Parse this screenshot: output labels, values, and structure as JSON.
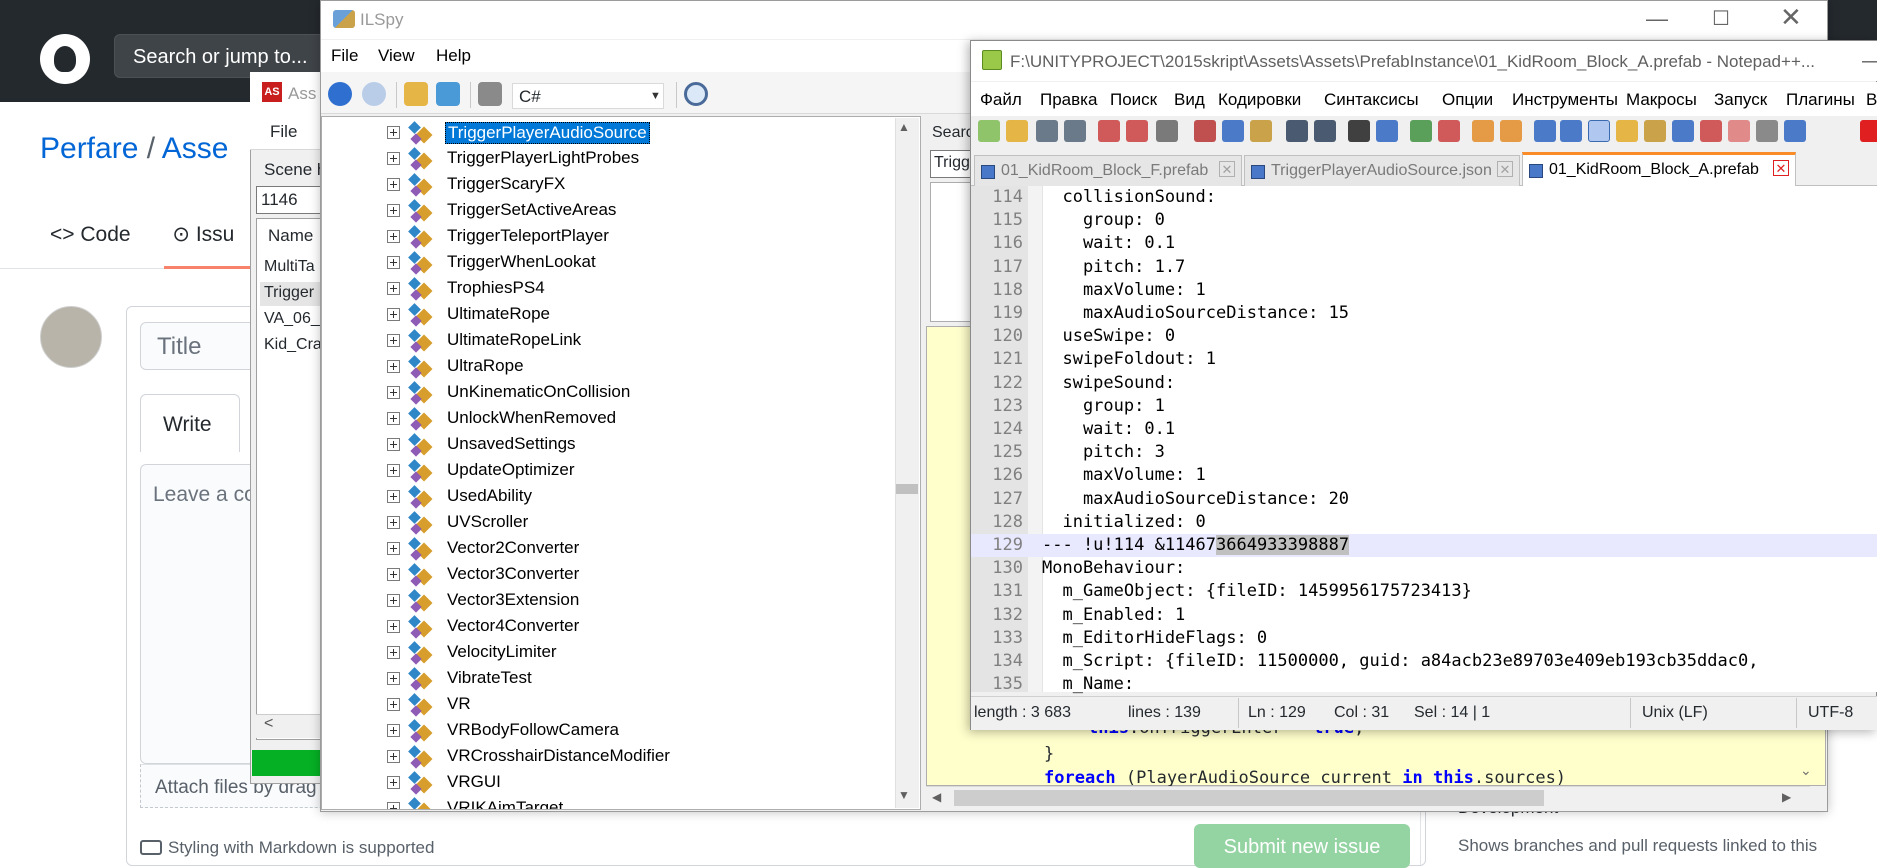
{
  "github": {
    "search_placeholder": "Search or jump to...",
    "repo_owner": "Perfare",
    "repo_sep": "/",
    "repo_name": "Asse",
    "tab_code": "<> Code",
    "tab_issues": "⊙ Issu",
    "title_placeholder": "Title",
    "write_tab": "Write",
    "comment_placeholder": "Leave a co",
    "attach_text": "Attach files by drag",
    "markdown_note": "Styling with Markdown is supported",
    "submit_label": "Submit new issue",
    "dev_title": "Development",
    "dev_desc": "Shows branches and pull requests linked to this"
  },
  "assetstudio": {
    "title": "Ass",
    "menu_file": "File",
    "scene_label": "Scene h",
    "search_value": "1146",
    "col_name": "Name",
    "rows": [
      "MultiTa",
      "Trigger",
      "VA_06_",
      "Kid_Cra"
    ],
    "scroll_left": "<"
  },
  "ilspy": {
    "title": "ILSpy",
    "min": "—",
    "max": "☐",
    "close": "✕",
    "menu": [
      "File",
      "View",
      "Help"
    ],
    "language": "C#",
    "search_label": "Searc",
    "search_value": "Trigg",
    "tree": [
      "TriggerPlayerAudioSource",
      "TriggerPlayerLightProbes",
      "TriggerScaryFX",
      "TriggerSetActiveAreas",
      "TriggerTeleportPlayer",
      "TriggerWhenLookat",
      "TrophiesPS4",
      "UltimateRope",
      "UltimateRopeLink",
      "UltraRope",
      "UnKinematicOnCollision",
      "UnlockWhenRemoved",
      "UnsavedSettings",
      "UpdateOptimizer",
      "UsedAbility",
      "UVScroller",
      "Vector2Converter",
      "Vector3Converter",
      "Vector3Extension",
      "Vector4Converter",
      "VelocityLimiter",
      "VibrateTest",
      "VR",
      "VRBodyFollowCamera",
      "VRCrosshairDistanceModifier",
      "VRGUI",
      "VRIKAimTarget"
    ],
    "code_line1_a": "this",
    "code_line1_b": ".onTriggerEnter = ",
    "code_line1_c": "true",
    "code_line1_d": ";",
    "code_line2": "}",
    "code_line3_kw": "foreach",
    "code_line3_a": " (PlayerAudioSource current ",
    "code_line3_in": "in",
    "code_line3_this": "this",
    "code_line3_b": ".sources)"
  },
  "notepad": {
    "title": "F:\\UNITYPROJECT\\2015skript\\Assets\\Assets\\PrefabInstance\\01_KidRoom_Block_A.prefab - Notepad++...",
    "menu": [
      "Файл",
      "Правка",
      "Поиск",
      "Вид",
      "Кодировки",
      "Синтаксисы",
      "Опции",
      "Инструменты",
      "Макросы",
      "Запуск",
      "Плагины",
      "В"
    ],
    "tabs": [
      "01_KidRoom_Block_F.prefab",
      "TriggerPlayerAudioSource.json",
      "01_KidRoom_Block_A.prefab"
    ],
    "active_tab": 2,
    "lines": [
      {
        "n": "114",
        "t": "  collisionSound:"
      },
      {
        "n": "115",
        "t": "    group: 0"
      },
      {
        "n": "116",
        "t": "    wait: 0.1"
      },
      {
        "n": "117",
        "t": "    pitch: 1.7"
      },
      {
        "n": "118",
        "t": "    maxVolume: 1"
      },
      {
        "n": "119",
        "t": "    maxAudioSourceDistance: 15"
      },
      {
        "n": "120",
        "t": "  useSwipe: 0"
      },
      {
        "n": "121",
        "t": "  swipeFoldout: 1"
      },
      {
        "n": "122",
        "t": "  swipeSound:"
      },
      {
        "n": "123",
        "t": "    group: 1"
      },
      {
        "n": "124",
        "t": "    wait: 0.1"
      },
      {
        "n": "125",
        "t": "    pitch: 3"
      },
      {
        "n": "126",
        "t": "    maxVolume: 1"
      },
      {
        "n": "127",
        "t": "    maxAudioSourceDistance: 20"
      },
      {
        "n": "128",
        "t": "  initialized: 0"
      },
      {
        "n": "129",
        "t": "--- !u!114 &11467",
        "hl": "3664933398887"
      },
      {
        "n": "130",
        "t": "MonoBehaviour:"
      },
      {
        "n": "131",
        "t": "  m_GameObject: {fileID: 1459956175723413}"
      },
      {
        "n": "132",
        "t": "  m_Enabled: 1"
      },
      {
        "n": "133",
        "t": "  m_EditorHideFlags: 0"
      },
      {
        "n": "134",
        "t": "  m_Script: {fileID: 11500000, guid: a84acb23e89703e409eb193cb35ddac0,"
      },
      {
        "n": "135",
        "t": "  m_Name:"
      }
    ],
    "status": {
      "length": "length : 3 683",
      "lines": "lines : 139",
      "ln": "Ln : 129",
      "col": "Col : 31",
      "sel": "Sel : 14 | 1",
      "eol": "Unix (LF)",
      "enc": "UTF-8"
    }
  }
}
